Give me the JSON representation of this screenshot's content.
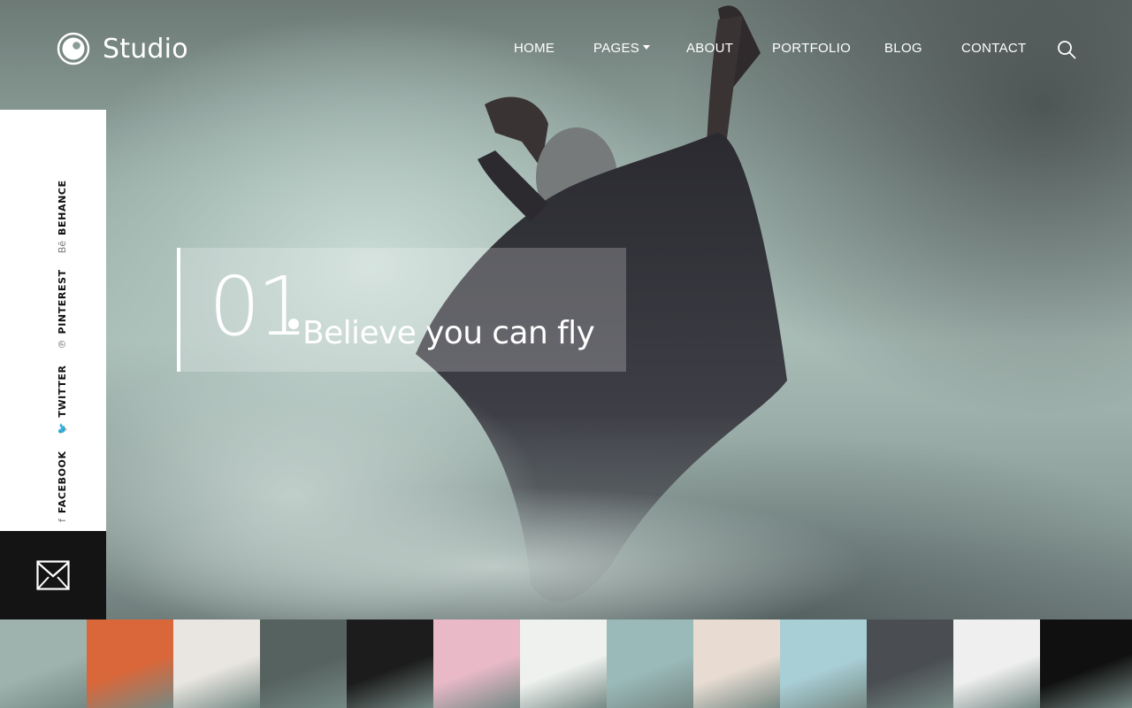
{
  "brand": {
    "name": "Studio"
  },
  "nav": {
    "items": [
      {
        "label": "HOME"
      },
      {
        "label": "PAGES"
      },
      {
        "label": "ABOUT"
      },
      {
        "label": "PORTFOLIO"
      },
      {
        "label": "BLOG"
      },
      {
        "label": "CONTACT"
      }
    ],
    "search_icon": "search-icon"
  },
  "social": {
    "items": [
      {
        "label": "FACEBOOK",
        "icon": "f"
      },
      {
        "label": "TWITTER",
        "icon": "🐦"
      },
      {
        "label": "PINTEREST",
        "icon": "℗"
      },
      {
        "label": "BEHANCE",
        "icon": "Bē"
      }
    ],
    "mail_icon": "envelope-icon"
  },
  "slide": {
    "number": "01",
    "title": "Believe you can fly"
  },
  "thumbnails": [
    {
      "name": "dancer-in-mist",
      "color": "#9fb3ae"
    },
    {
      "name": "orange-wall-window",
      "color": "#d9673a"
    },
    {
      "name": "deer",
      "color": "#e9e6e1"
    },
    {
      "name": "jumping-legs",
      "color": "#56625f"
    },
    {
      "name": "light-streaks",
      "color": "#1c1c1c"
    },
    {
      "name": "pink-lips",
      "color": "#e9b9c8"
    },
    {
      "name": "hand-with-rose",
      "color": "#eef1ee"
    },
    {
      "name": "dancer-with-cloth",
      "color": "#9ab9b9"
    },
    {
      "name": "woman-curtain",
      "color": "#e8dcd2"
    },
    {
      "name": "red-building",
      "color": "#a9cfd6"
    },
    {
      "name": "colorful-facade",
      "color": "#4a4e52"
    },
    {
      "name": "lone-walker-snow",
      "color": "#efefef"
    },
    {
      "name": "smoke-woman",
      "color": "#101010"
    }
  ],
  "colors": {
    "accent": "#ffffff",
    "panel_dark": "#141414"
  }
}
